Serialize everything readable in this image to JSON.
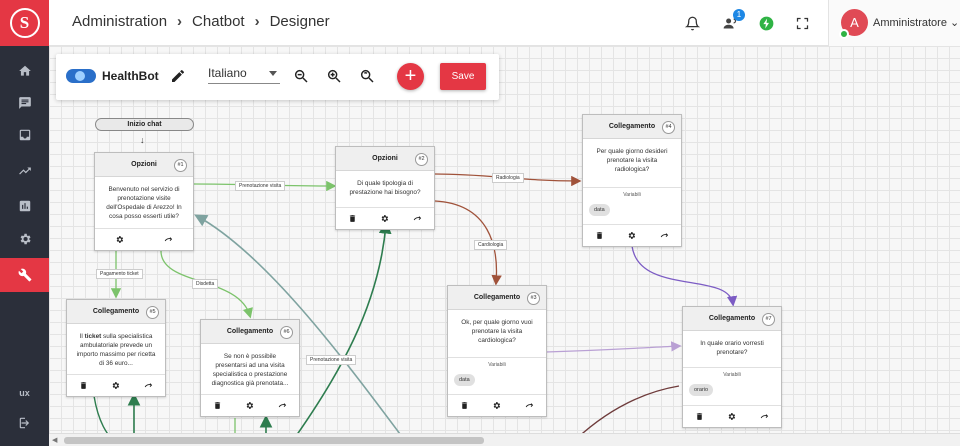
{
  "header": {
    "breadcrumb": [
      "Administration",
      "Chatbot",
      "Designer"
    ],
    "notification_badge": "1",
    "user_initial": "A",
    "user_name": "Amministratore"
  },
  "sidebar": {
    "items": [
      {
        "name": "home-icon"
      },
      {
        "name": "chat-icon"
      },
      {
        "name": "inbox-icon"
      },
      {
        "name": "trending-icon"
      },
      {
        "name": "bar-chart-icon"
      },
      {
        "name": "gear-icon"
      },
      {
        "name": "wrench-icon",
        "active": true
      },
      {
        "name": "ux-icon"
      },
      {
        "name": "logout-icon"
      }
    ],
    "ux_label": "ux"
  },
  "toolbar": {
    "bot_name": "HealthBot",
    "language": "Italiano",
    "add_label": "+",
    "save_label": "Save"
  },
  "canvas": {
    "start_label": "Inizio chat",
    "start_arrow": "↓",
    "nodes": [
      {
        "id": "n1",
        "title": "Opzioni",
        "num": "#1",
        "text": "Benvenuto nel servizio di prenotazione visite dell'Ospedale di Arezzo! In cosa posso esserti utile?"
      },
      {
        "id": "n2",
        "title": "Opzioni",
        "num": "#2",
        "text": "Di quale tipologia di prestazione hai bisogno?"
      },
      {
        "id": "n3",
        "title": "Collegamento",
        "num": "#3",
        "text": "Ok, per quale giorno vuoi prenotare la visita cardiologica?",
        "vars_label": "Variabili",
        "var": "data"
      },
      {
        "id": "n4",
        "title": "Collegamento",
        "num": "#4",
        "text": "Per quale giorno desideri prenotare la visita radiologica?",
        "vars_label": "Variabili",
        "var": "data"
      },
      {
        "id": "n5",
        "title": "Collegamento",
        "num": "#5",
        "text_bold": "ticket",
        "text_pre": "Il ",
        "text_post": " sulla specialistica ambulatoriale prevede un importo massimo per ricetta di 36 euro..."
      },
      {
        "id": "n6",
        "title": "Collegamento",
        "num": "#6",
        "text": "Se non è possibile presentarsi ad una visita specialistica o prestazione diagnostica già prenotata..."
      },
      {
        "id": "n7",
        "title": "Collegamento",
        "num": "#7",
        "text": "In quale orario vorresti prenotare?",
        "vars_label": "Variabili",
        "var": "orario"
      }
    ],
    "edge_labels": {
      "e1": "Prenotazione visita",
      "e2": "Radiologia",
      "e3": "Cardiologia",
      "e4": "Pagamento ticket",
      "e5": "Disdetta",
      "e6": "Prenotazione visita"
    },
    "edge_colors": {
      "green": "#7cc36b",
      "darkgreen": "#2e7d4f",
      "brown": "#a0523a",
      "purple": "#7c5cc4",
      "lilac": "#b9a0d4",
      "teal": "#7fa3a0",
      "darkbrown": "#6e3b3b"
    }
  },
  "colors": {
    "accent": "#e43744",
    "sidebar_bg": "#2b2f3a",
    "badge": "#1e88e5",
    "online": "#2fb344"
  }
}
